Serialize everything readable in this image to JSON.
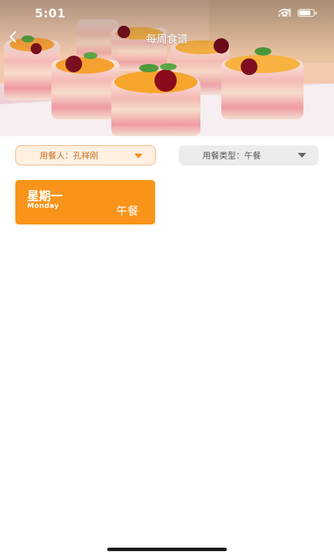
{
  "status_bar": {
    "time": "5:01",
    "wifi_icon": "wifi-icon",
    "signal_icon": "cellular-signal-icon",
    "battery_icon": "battery-icon",
    "battery_level": 0.9
  },
  "nav": {
    "title": "每周食谱",
    "back_icon": "chevron-left-icon"
  },
  "hero": {
    "image": "dessert-cups-photo"
  },
  "filters": {
    "user": {
      "label": "用餐人：孔祥刚",
      "caret_icon": "caret-down-icon",
      "accent": "#f29321"
    },
    "meal_type": {
      "label": "用餐类型：午餐",
      "caret_icon": "caret-down-icon"
    }
  },
  "meals": [
    {
      "day": "星期一",
      "day_en": "Monday",
      "meal": "午餐",
      "color": "#f89419"
    }
  ]
}
